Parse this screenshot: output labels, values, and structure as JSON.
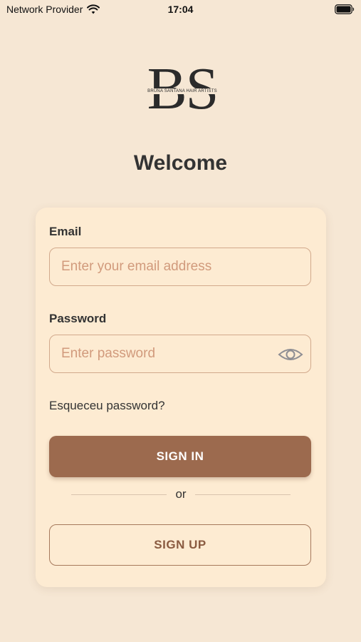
{
  "status_bar": {
    "carrier": "Network Provider",
    "time": "17:04"
  },
  "logo": {
    "letters": "BS",
    "tagline": "BRUNA SANTANA HAIR ARTISTS"
  },
  "welcome": "Welcome",
  "form": {
    "email_label": "Email",
    "email_placeholder": "Enter your email address",
    "password_label": "Password",
    "password_placeholder": "Enter password",
    "forgot_link": "Esqueceu password?",
    "signin_label": "SIGN IN",
    "divider_text": "or",
    "signup_label": "SIGN UP"
  },
  "colors": {
    "background": "#f6e7d4",
    "card": "#fdebd2",
    "primary": "#9c6a4e",
    "border": "#d2a98c",
    "placeholder": "#d19a7c"
  },
  "icons": {
    "wifi": "wifi-icon",
    "battery": "battery-icon",
    "password_toggle": "eye-icon"
  }
}
